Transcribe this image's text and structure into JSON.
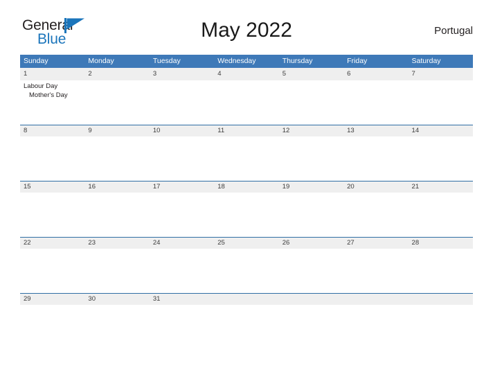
{
  "brand": {
    "name_part1": "General",
    "name_part2": "Blue",
    "flag_icon": "blue-triangle-flag-icon",
    "color_dark": "#231f20",
    "color_blue": "#1b75bb"
  },
  "header": {
    "title": "May 2022",
    "region": "Portugal"
  },
  "calendar": {
    "accent_color": "#3e79b8",
    "rule_color": "#2e6da4",
    "number_band_color": "#efefef",
    "weekdays": [
      "Sunday",
      "Monday",
      "Tuesday",
      "Wednesday",
      "Thursday",
      "Friday",
      "Saturday"
    ],
    "weeks": [
      {
        "days": [
          {
            "num": "1",
            "events": [
              {
                "text": "Labour Day",
                "indent": false
              },
              {
                "text": "Mother's Day",
                "indent": true
              }
            ]
          },
          {
            "num": "2",
            "events": []
          },
          {
            "num": "3",
            "events": []
          },
          {
            "num": "4",
            "events": []
          },
          {
            "num": "5",
            "events": []
          },
          {
            "num": "6",
            "events": []
          },
          {
            "num": "7",
            "events": []
          }
        ]
      },
      {
        "days": [
          {
            "num": "8",
            "events": []
          },
          {
            "num": "9",
            "events": []
          },
          {
            "num": "10",
            "events": []
          },
          {
            "num": "11",
            "events": []
          },
          {
            "num": "12",
            "events": []
          },
          {
            "num": "13",
            "events": []
          },
          {
            "num": "14",
            "events": []
          }
        ]
      },
      {
        "days": [
          {
            "num": "15",
            "events": []
          },
          {
            "num": "16",
            "events": []
          },
          {
            "num": "17",
            "events": []
          },
          {
            "num": "18",
            "events": []
          },
          {
            "num": "19",
            "events": []
          },
          {
            "num": "20",
            "events": []
          },
          {
            "num": "21",
            "events": []
          }
        ]
      },
      {
        "days": [
          {
            "num": "22",
            "events": []
          },
          {
            "num": "23",
            "events": []
          },
          {
            "num": "24",
            "events": []
          },
          {
            "num": "25",
            "events": []
          },
          {
            "num": "26",
            "events": []
          },
          {
            "num": "27",
            "events": []
          },
          {
            "num": "28",
            "events": []
          }
        ]
      },
      {
        "days": [
          {
            "num": "29",
            "events": []
          },
          {
            "num": "30",
            "events": []
          },
          {
            "num": "31",
            "events": []
          },
          {
            "num": "",
            "events": []
          },
          {
            "num": "",
            "events": []
          },
          {
            "num": "",
            "events": []
          },
          {
            "num": "",
            "events": []
          }
        ]
      }
    ]
  }
}
